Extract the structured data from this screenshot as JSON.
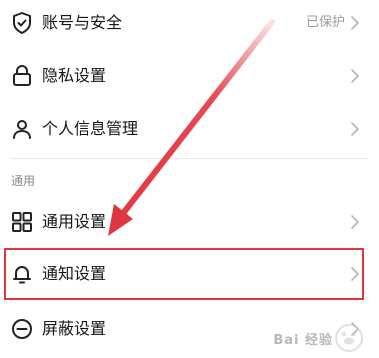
{
  "settings": {
    "rows": [
      {
        "label": "账号与安全",
        "status": "已保护",
        "icon": "shield-check-icon"
      },
      {
        "label": "隐私设置",
        "status": "",
        "icon": "lock-icon"
      },
      {
        "label": "个人信息管理",
        "status": "",
        "icon": "person-icon"
      },
      {
        "label": "通用设置",
        "status": "",
        "icon": "grid-icon"
      },
      {
        "label": "通知设置",
        "status": "",
        "icon": "bell-icon"
      },
      {
        "label": "屏蔽设置",
        "status": "",
        "icon": "block-icon"
      }
    ],
    "section_general": "通用"
  },
  "watermark": {
    "text": "Bai 经验",
    "logo": "baidu-paw-logo"
  },
  "colors": {
    "highlight": "#e3353f",
    "arrow": "#e3353f"
  }
}
